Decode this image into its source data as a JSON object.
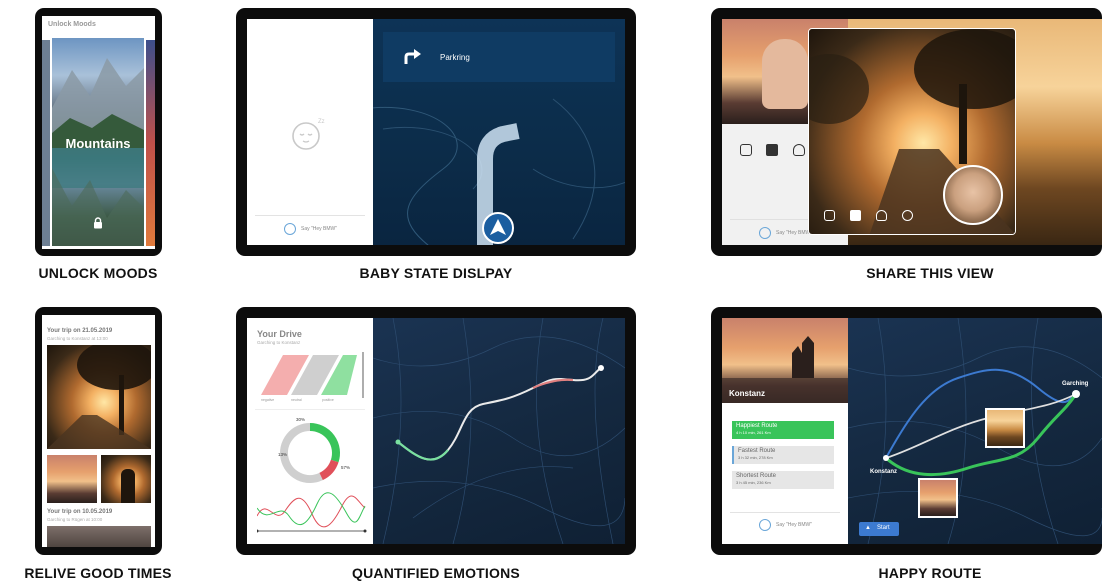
{
  "captions": {
    "unlock_moods": "UNLOCK MOODS",
    "baby_state": "BABY STATE DISLPAY",
    "share_view": "SHARE THIS VIEW",
    "relive": "RELIVE GOOD TIMES",
    "quantified": "QUANTIFIED EMOTIONS",
    "happy_route": "HAPPY ROUTE"
  },
  "unlock": {
    "header": "Unlock Moods",
    "card_title": "Mountains",
    "icon": "lock-icon"
  },
  "baby": {
    "direction_label": "Parkring",
    "voice_prompt": "Say \"Hey BMW\"",
    "icons": [
      "baby-sleeping-icon",
      "turn-right-icon",
      "navigation-arrow-icon",
      "microphone-icon"
    ]
  },
  "share": {
    "voice_prompt": "Say \"Hey BMW\"",
    "icons": [
      "instagram-icon",
      "facebook-icon",
      "snapchat-icon",
      "whatsapp-icon"
    ]
  },
  "relive": {
    "trip1_title": "Your trip on 21.05.2019",
    "trip1_sub": "Garching to Konstanz at 13:00",
    "trip2_title": "Your trip on 10.05.2019",
    "trip2_sub": "Garching to Rügen at 10:00"
  },
  "quantified": {
    "title": "Your Drive",
    "subtitle": "Garching to Konstanz",
    "bar_labels": [
      "negative",
      "neutral",
      "positive"
    ],
    "donut_labels": [
      "30%",
      "13%",
      "57%"
    ],
    "chart_data": {
      "type": "pie",
      "categories": [
        "30%",
        "13%",
        "57%"
      ],
      "values": [
        30,
        13,
        57
      ],
      "title": "",
      "colors": [
        "#39c45a",
        "#e0505a",
        "#cfcfcf"
      ]
    }
  },
  "happy": {
    "city": "Konstanz",
    "routes": [
      {
        "name": "Happiest Route",
        "detail": "4 h 10 min, 261 Km"
      },
      {
        "name": "Fastest Route",
        "detail": "3 h 32 min, 278 Km"
      },
      {
        "name": "Shortest Route",
        "detail": "3 h 45 min, 236 Km"
      }
    ],
    "voice_prompt": "Say \"Hey BMW\"",
    "start_label": "Start",
    "map_start": "Garching",
    "map_end": "Konstanz"
  },
  "colors": {
    "accent_green": "#39c45a",
    "nav_blue": "#0d3356",
    "map_dark": "#14283f",
    "negative_red": "#e0505a"
  }
}
